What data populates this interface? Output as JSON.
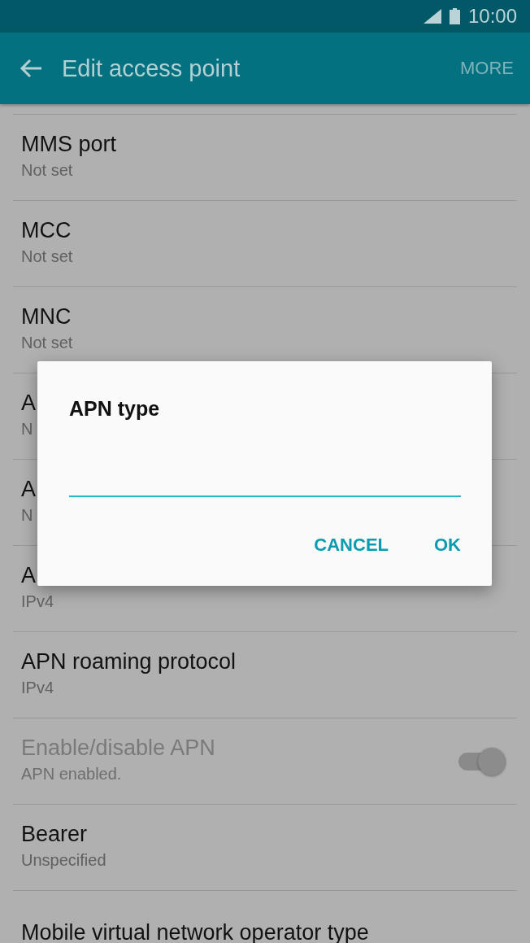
{
  "status_bar": {
    "time": "10:00"
  },
  "app_bar": {
    "title": "Edit access point",
    "action": "MORE"
  },
  "settings": [
    {
      "kind": "text",
      "title": "MMS port",
      "value": "Not set",
      "disabled": false
    },
    {
      "kind": "text",
      "title": "MCC",
      "value": "Not set",
      "disabled": false
    },
    {
      "kind": "text",
      "title": "MNC",
      "value": "Not set",
      "disabled": false
    },
    {
      "kind": "text",
      "title": "A",
      "value": "N",
      "disabled": false
    },
    {
      "kind": "text",
      "title": "A",
      "value": "N",
      "disabled": false
    },
    {
      "kind": "text",
      "title": "A",
      "value": "IPv4",
      "disabled": false
    },
    {
      "kind": "text",
      "title": "APN roaming protocol",
      "value": "IPv4",
      "disabled": false
    },
    {
      "kind": "toggle",
      "title": "Enable/disable APN",
      "value": "APN enabled.",
      "disabled": true,
      "on": true
    },
    {
      "kind": "text",
      "title": "Bearer",
      "value": "Unspecified",
      "disabled": false
    },
    {
      "kind": "text",
      "title": "Mobile virtual network operator type",
      "disabled": false
    }
  ],
  "dialog": {
    "title": "APN type",
    "buttons": [
      "CANCEL",
      "OK"
    ]
  }
}
